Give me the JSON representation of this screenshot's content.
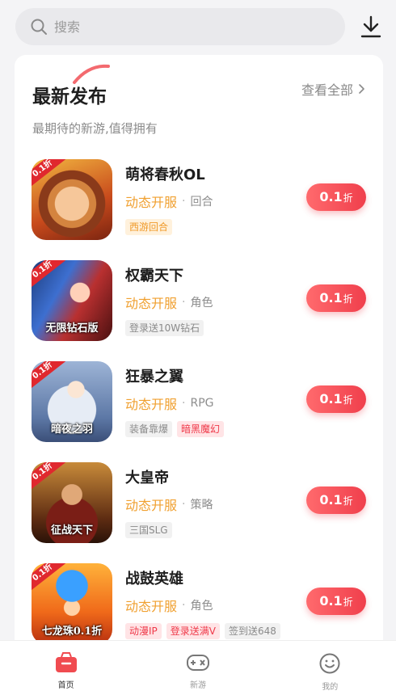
{
  "search": {
    "placeholder": "搜索"
  },
  "header": {
    "download_icon": "download-icon"
  },
  "section": {
    "title": "最新发布",
    "view_all": "查看全部",
    "subtitle": "最期待的新游,值得拥有"
  },
  "games": [
    {
      "name": "萌将春秋OL",
      "status": "动态开服",
      "genre": "回合",
      "tags": [
        {
          "text": "西游回合",
          "style": "orange"
        }
      ],
      "discount_num": "0.1",
      "discount_unit": "折",
      "badge": "0.1折",
      "caption": ""
    },
    {
      "name": "权霸天下",
      "status": "动态开服",
      "genre": "角色",
      "tags": [
        {
          "text": "登录送10W钻石",
          "style": "gray"
        }
      ],
      "discount_num": "0.1",
      "discount_unit": "折",
      "badge": "0.1折",
      "caption": "无限钻石版"
    },
    {
      "name": "狂暴之翼",
      "status": "动态开服",
      "genre": "RPG",
      "tags": [
        {
          "text": "装备靠爆",
          "style": "gray"
        },
        {
          "text": "暗黑魔幻",
          "style": "red"
        }
      ],
      "discount_num": "0.1",
      "discount_unit": "折",
      "badge": "0.1折",
      "caption": "暗夜之羽"
    },
    {
      "name": "大皇帝",
      "status": "动态开服",
      "genre": "策略",
      "tags": [
        {
          "text": "三国SLG",
          "style": "gray"
        }
      ],
      "discount_num": "0.1",
      "discount_unit": "折",
      "badge": "0.1折",
      "caption": "征战天下"
    },
    {
      "name": "战鼓英雄",
      "status": "动态开服",
      "genre": "角色",
      "tags": [
        {
          "text": "动漫IP",
          "style": "red"
        },
        {
          "text": "登录送满V",
          "style": "red"
        },
        {
          "text": "签到送648",
          "style": "gray"
        }
      ],
      "discount_num": "0.1",
      "discount_unit": "折",
      "badge": "0.1折",
      "caption": "七龙珠0.1折"
    }
  ],
  "nav": [
    {
      "label": "首页",
      "icon": "home-bag-icon",
      "active": true
    },
    {
      "label": "新游",
      "icon": "gamepad-icon",
      "active": false
    },
    {
      "label": "我的",
      "icon": "smiley-icon",
      "active": false
    }
  ],
  "colors": {
    "accent": "#f03f4c",
    "status_orange": "#f0a030",
    "background": "#f4f4f6"
  }
}
